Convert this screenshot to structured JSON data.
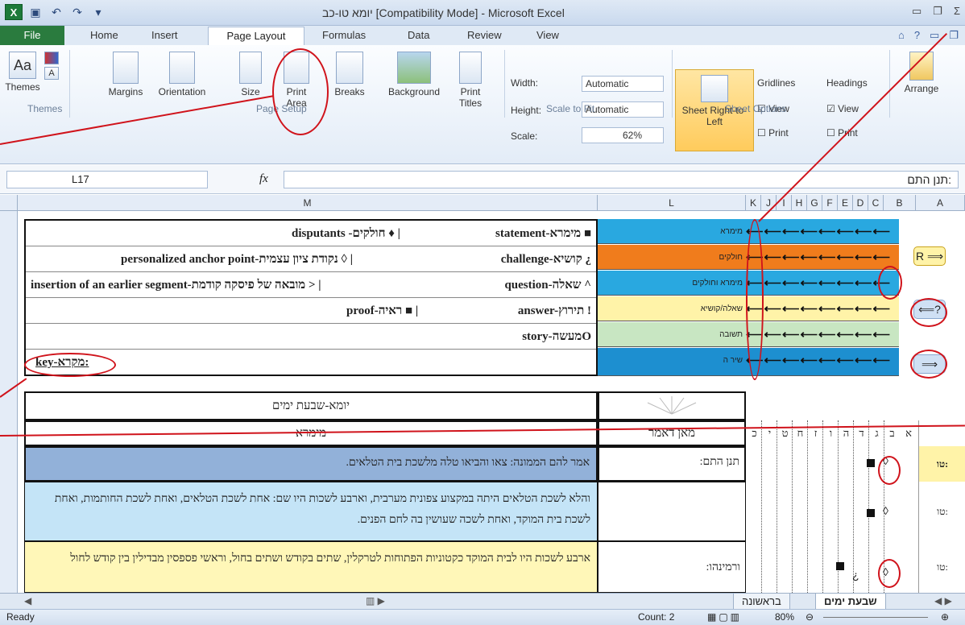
{
  "window": {
    "title": "יומא טו-כב [Compatibility Mode] - Microsoft Excel"
  },
  "ribbon_tabs": [
    "File",
    "Home",
    "Insert",
    "Page Layout",
    "Formulas",
    "Data",
    "Review",
    "View"
  ],
  "ribbon": {
    "themes": {
      "label": "Themes",
      "group": "Themes"
    },
    "margins": "Margins",
    "orientation": "Orientation",
    "size": "Size",
    "print_area": "Print Area",
    "breaks": "Breaks",
    "background": "Background",
    "print_titles": "Print Titles",
    "page_setup_group": "Page Setup",
    "width_label": "Width:",
    "width_value": "Automatic",
    "height_label": "Height:",
    "height_value": "Automatic",
    "scale_label": "Scale:",
    "scale_value": "62%",
    "scale_group": "Scale to Fit",
    "sheet_rtl": "Sheet Right-to-Left",
    "gridlines": "Gridlines",
    "headings": "Headings",
    "view": "View",
    "print": "Print",
    "sheet_options_group": "Sheet Options",
    "arrange": "Arrange"
  },
  "formula_bar": {
    "name_box": "L17",
    "content": "תנן התם:"
  },
  "columns": [
    "M",
    "L",
    "K",
    "J",
    "I",
    "H",
    "G",
    "F",
    "E",
    "D",
    "C",
    "B",
    "A"
  ],
  "key": {
    "rows": [
      {
        "left": "disputants -חולקים ♦ |",
        "right": "statement-מימרא ■"
      },
      {
        "left": "personalized anchor point-נקודת ציון עצמית ◊ |",
        "right": "challenge-קושיא ¿"
      },
      {
        "left": "insertion of an earlier segment-מובאה של פיסקה קודמת > |",
        "right": "question-שאלה ^"
      },
      {
        "left": "proof-ראיה ■ |",
        "right": "answer-תירוץ !"
      },
      {
        "left": "",
        "right": "story-מעשהO"
      },
      {
        "left": "key-מקרא:",
        "right": ""
      }
    ],
    "strip": [
      {
        "label": "מימרא",
        "color": "#29a8e0"
      },
      {
        "label": "חולקים",
        "color": "#f07c1c"
      },
      {
        "label": "מימרא וחולקים",
        "color": "#29a8e0"
      },
      {
        "label": "שאלה/קושיא",
        "color": "#fff3a8"
      },
      {
        "label": "תשובה",
        "color": "#c8e6c2"
      },
      {
        "label": "שיר ה",
        "color": "#1d8fd0"
      }
    ],
    "arrows": "⟵⟵⟵⟵⟵⟵⟵⟵"
  },
  "side_arrows": {
    "r": "R ⟹",
    "q": "⟸?",
    "b": "⟹"
  },
  "table": {
    "title": "יומא-שבעת ימים",
    "h_memra": "מימרא",
    "h_source": "מאן דאמר",
    "heb_cols": [
      "כ",
      "י",
      "ט",
      "ח",
      "ז",
      "ו",
      "ה",
      "ד",
      "ג",
      "ב",
      "א"
    ],
    "rows": [
      {
        "text": "אמר להם הממונה: צאו והביאו טלה מלשכת בית הטלאים.",
        "source": "תנן התם:",
        "marker": "טו:"
      },
      {
        "text": "והלא לשכת הטלאים היתה במקצוע צפונית מערבית, וארבע לשכות היו שם: אחת לשכת הטלאים, ואחת לשכת החותמות, ואחת לשכת בית המוקד, ואחת לשכה שעושין בה לחם הפנים.",
        "source": "",
        "marker": "טו:"
      },
      {
        "text": "ארבע לשכות היו לבית המוקד כקטוניות הפתוחות לטרקלין, שתים בקודש ושתים בחול, וראשי פספסין מבדילין בין קודש לחול",
        "source": "ורמינהו:",
        "marker": "טו:"
      }
    ]
  },
  "sheet_tabs": {
    "active": "שבעת ימים",
    "other": "בראשונה"
  },
  "status": {
    "ready": "Ready",
    "count": "Count: 2",
    "zoom": "80%"
  }
}
